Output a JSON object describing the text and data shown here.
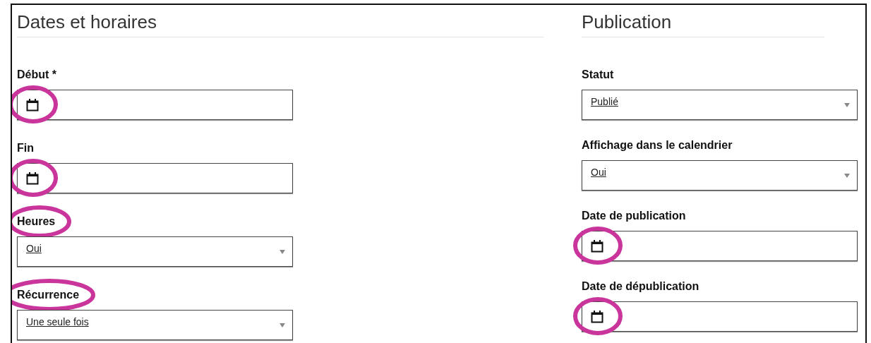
{
  "sections": [
    {
      "title": "Dates et horaires",
      "fields": [
        {
          "label": "Début *",
          "kind": "date",
          "icon_circled": true,
          "label_circled": false
        },
        {
          "label": "Fin",
          "kind": "date",
          "icon_circled": true,
          "label_circled": false
        },
        {
          "label": "Heures",
          "kind": "select",
          "value": "Oui",
          "label_circled": true
        },
        {
          "label": "Récurrence",
          "kind": "select",
          "value": "Une seule fois",
          "label_circled": true
        }
      ]
    },
    {
      "title": "Publication",
      "fields": [
        {
          "label": "Statut",
          "kind": "select",
          "value": "Publié",
          "label_circled": false
        },
        {
          "label": "Affichage dans le calendrier",
          "kind": "select",
          "value": "Oui",
          "label_circled": false
        },
        {
          "label": "Date de publication",
          "kind": "date",
          "icon_circled": true,
          "label_circled": false
        },
        {
          "label": "Date de dépublication",
          "kind": "date",
          "icon_circled": true,
          "label_circled": false
        }
      ]
    }
  ]
}
